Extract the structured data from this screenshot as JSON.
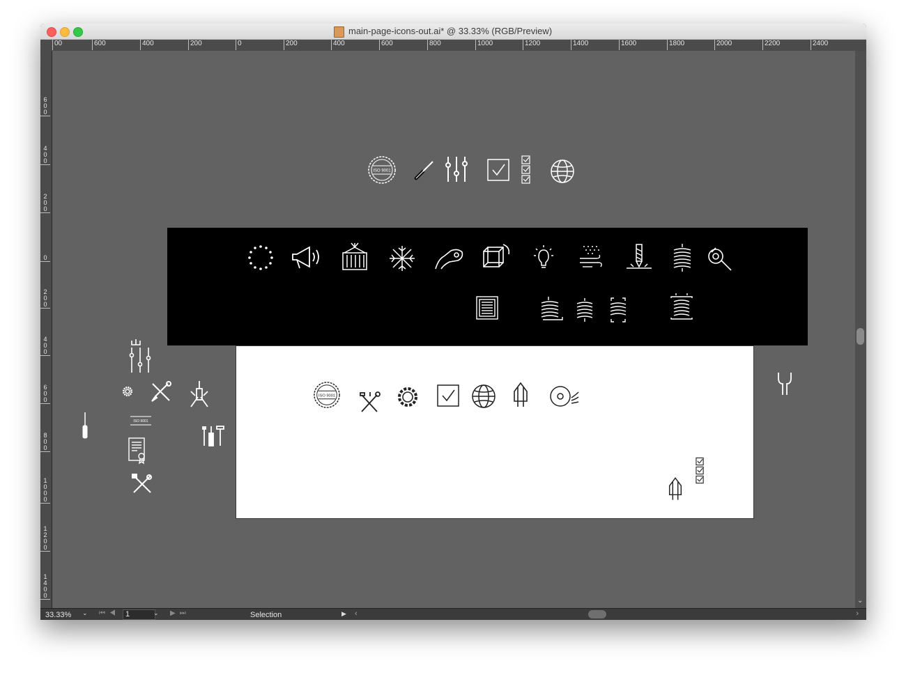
{
  "window": {
    "title": "main-page-icons-out.ai* @ 33.33% (RGB/Preview)",
    "file_icon": "illustrator-file-icon"
  },
  "ruler": {
    "horizontal": [
      "00",
      "600",
      "400",
      "200",
      "0",
      "200",
      "400",
      "600",
      "800",
      "1000",
      "1200",
      "1400",
      "1600",
      "1800",
      "2000",
      "2200",
      "2400"
    ],
    "vertical": [
      "600",
      "400",
      "200",
      "0",
      "200",
      "400",
      "600",
      "800",
      "1000",
      "1200",
      "1400"
    ]
  },
  "status": {
    "zoom": "33.33%",
    "page": "1",
    "tool": "Selection"
  },
  "colors": {
    "canvas": "#626262",
    "band": "#000000",
    "artboard": "#ffffff",
    "chrome": "#3b3b3b"
  },
  "icons": {
    "top_row": [
      "iso-9001-badge-icon",
      "screwdriver-icon",
      "sliders-icon",
      "checkbox-icon",
      "checklist-icon",
      "globe-icon"
    ],
    "band_row1": [
      "eu-stars-icon",
      "megaphone-icon",
      "cargo-container-icon",
      "snowflake-icon",
      "robot-arm-icon",
      "cube-rotate-icon",
      "lightbulb-icon",
      "wind-particles-icon",
      "drill-icon",
      "coil-icon",
      "wrench-hand-icon"
    ],
    "band_row2": [
      "filter-frame-icon",
      "coil-base-icon",
      "coil-icon",
      "coil-bracket-icon",
      "coil-frame-icon"
    ],
    "artboard_row": [
      "iso-9001-badge-icon",
      "tools-cross-icon",
      "gear-icon",
      "checkbox-icon",
      "globe-icon",
      "milling-cutter-icon",
      "disc-icon"
    ],
    "left_cluster": [
      "sliders-icon",
      "gear-icon",
      "screwdriver-wrench-icon",
      "hand-screwdriver-icon",
      "screwdriver-icon",
      "iso-9001-label-icon",
      "certificate-icon",
      "tools-set-icon",
      "tools-cross-icon"
    ],
    "misc": [
      "milling-cutter-icon",
      "checklist-icon",
      "wrench-icon"
    ]
  },
  "iso_text": "ISO 9001"
}
